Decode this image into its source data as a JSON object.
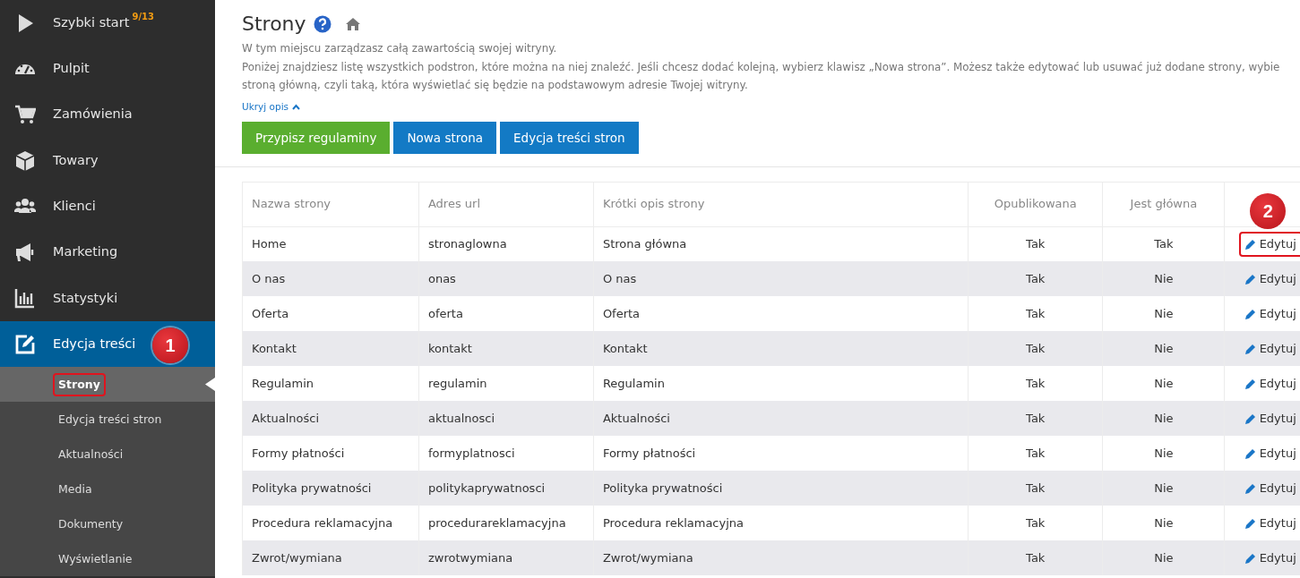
{
  "sidebar": {
    "items": [
      {
        "label": "Szybki start",
        "counter": "9/13",
        "selected": false
      },
      {
        "label": "Pulpit",
        "selected": false
      },
      {
        "label": "Zamówienia",
        "selected": false
      },
      {
        "label": "Towary",
        "selected": false
      },
      {
        "label": "Klienci",
        "selected": false
      },
      {
        "label": "Marketing",
        "selected": false
      },
      {
        "label": "Statystyki",
        "selected": false
      },
      {
        "label": "Edycja treści",
        "selected": true,
        "annotation": "1",
        "children": [
          {
            "label": "Strony",
            "selected": true,
            "highlighted": true
          },
          {
            "label": "Edycja treści stron",
            "selected": false,
            "highlighted": false
          },
          {
            "label": "Aktualności",
            "selected": false,
            "highlighted": false
          },
          {
            "label": "Media",
            "selected": false,
            "highlighted": false
          },
          {
            "label": "Dokumenty",
            "selected": false,
            "highlighted": false
          },
          {
            "label": "Wyświetlanie",
            "selected": false,
            "highlighted": false
          }
        ]
      }
    ]
  },
  "page": {
    "title": "Strony",
    "description": [
      "W tym miejscu zarządzasz całą zawartością swojej witryny.",
      "Poniżej znajdziesz listę wszystkich podstron, które można na niej znaleźć. Jeśli chcesz dodać kolejną, wybierz klawisz „Nowa strona”. Możesz także edytować lub usuwać już dodane strony, wybie",
      "stroną główną, czyli taką, która wyświetlać się będzie na podstawowym adresie Twojej witryny."
    ],
    "toggle_label": "Ukryj opis",
    "buttons": [
      {
        "label": "Przypisz regulaminy",
        "kind": "success"
      },
      {
        "label": "Nowa strona",
        "kind": "primary"
      },
      {
        "label": "Edycja treści stron",
        "kind": "primary"
      }
    ]
  },
  "table": {
    "columns": [
      "Nazwa strony",
      "Adres url",
      "Krótki opis strony",
      "Opublikowana",
      "Jest główna"
    ],
    "action_annotation": "2",
    "rows": [
      {
        "cells": [
          "Home",
          "stronaglowna",
          "Strona główna",
          "Tak",
          "Tak"
        ],
        "action": "Edytuj",
        "highlighted": true
      },
      {
        "cells": [
          "O nas",
          "onas",
          "O nas",
          "Tak",
          "Nie"
        ],
        "action": "Edytuj",
        "highlighted": false
      },
      {
        "cells": [
          "Oferta",
          "oferta",
          "Oferta",
          "Tak",
          "Nie"
        ],
        "action": "Edytuj",
        "highlighted": false
      },
      {
        "cells": [
          "Kontakt",
          "kontakt",
          "Kontakt",
          "Tak",
          "Nie"
        ],
        "action": "Edytuj",
        "highlighted": false
      },
      {
        "cells": [
          "Regulamin",
          "regulamin",
          "Regulamin",
          "Tak",
          "Nie"
        ],
        "action": "Edytuj",
        "highlighted": false
      },
      {
        "cells": [
          "Aktualności",
          "aktualnosci",
          "Aktualności",
          "Tak",
          "Nie"
        ],
        "action": "Edytuj",
        "highlighted": false
      },
      {
        "cells": [
          "Formy płatności",
          "formyplatnosci",
          "Formy płatności",
          "Tak",
          "Nie"
        ],
        "action": "Edytuj",
        "highlighted": false
      },
      {
        "cells": [
          "Polityka prywatności",
          "politykaprywatnosci",
          "Polityka prywatności",
          "Tak",
          "Nie"
        ],
        "action": "Edytuj",
        "highlighted": false
      },
      {
        "cells": [
          "Procedura reklamacyjna",
          "procedurareklamacyjna",
          "Procedura reklamacyjna",
          "Tak",
          "Nie"
        ],
        "action": "Edytuj",
        "highlighted": false
      },
      {
        "cells": [
          "Zwrot/wymiana",
          "zwrotwymiana",
          "Zwrot/wymiana",
          "Tak",
          "Nie"
        ],
        "action": "Edytuj",
        "highlighted": false
      }
    ]
  }
}
